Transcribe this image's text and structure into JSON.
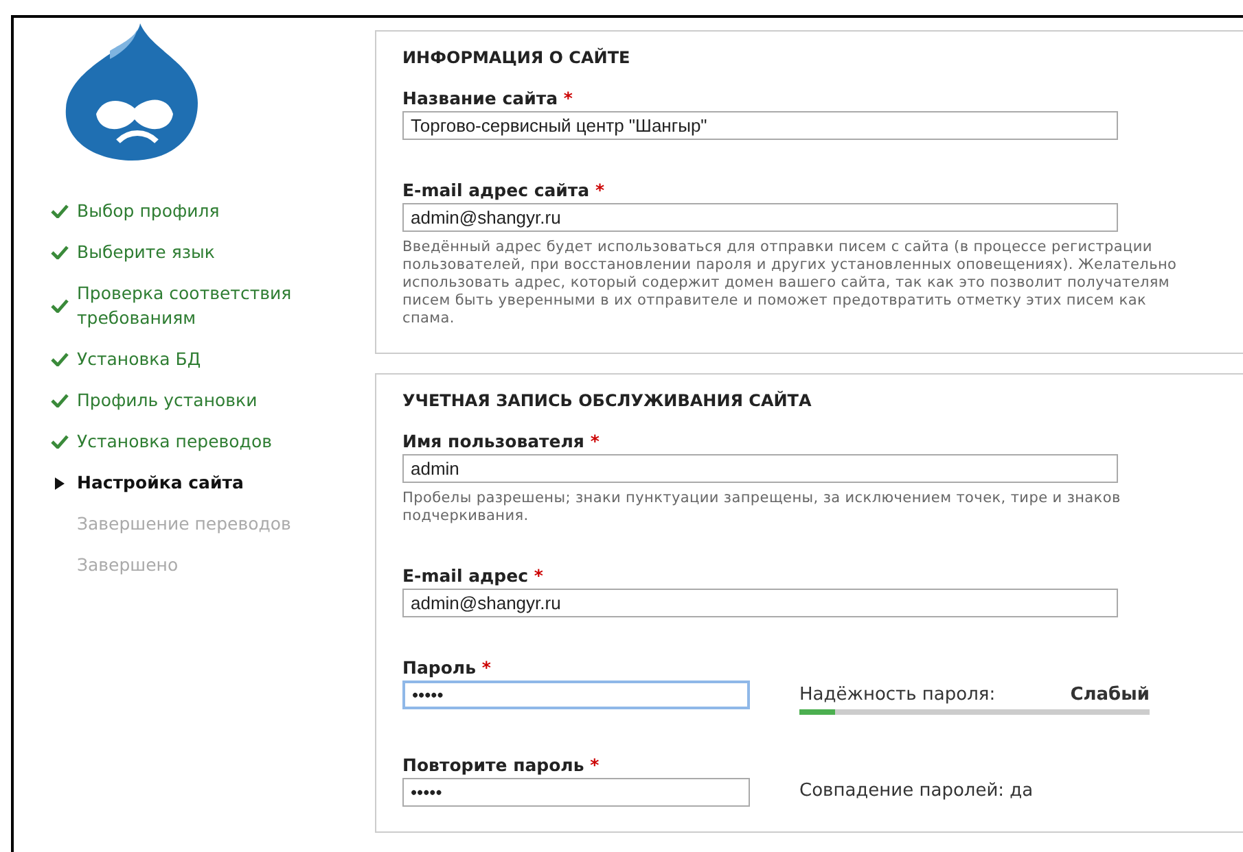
{
  "steps": [
    {
      "label": "Выбор профиля",
      "kind": "done"
    },
    {
      "label": "Выберите язык",
      "kind": "done"
    },
    {
      "label": "Проверка соответствия требованиям",
      "kind": "done"
    },
    {
      "label": "Установка БД",
      "kind": "done"
    },
    {
      "label": "Профиль установки",
      "kind": "done"
    },
    {
      "label": "Установка переводов",
      "kind": "done"
    },
    {
      "label": "Настройка сайта",
      "kind": "active"
    },
    {
      "label": "Завершение переводов",
      "kind": "pending"
    },
    {
      "label": "Завершено",
      "kind": "pending"
    }
  ],
  "fieldsets": [
    {
      "title": "ИНФОРМАЦИЯ О САЙТЕ",
      "fields": [
        {
          "kind": "text",
          "label": "Название сайта",
          "required_mark": "*",
          "value": "Торгово-сервисный центр \"Шангыр\""
        },
        {
          "kind": "text",
          "label": "E-mail адрес сайта",
          "required_mark": "*",
          "value": "admin@shangyr.ru",
          "description": "Введённый адрес будет использоваться для отправки писем с сайта (в процессе регистрации пользователей, при восстановлении пароля и других установленных оповещениях). Желательно использовать адрес, который содержит домен вашего сайта, так как это позволит получателям писем быть уверенными в их отправителе и поможет предотвратить отметку этих писем как спама."
        }
      ]
    },
    {
      "title": "УЧЕТНАЯ ЗАПИСЬ ОБСЛУЖИВАНИЯ САЙТА",
      "fields": [
        {
          "kind": "text",
          "label": "Имя пользователя",
          "required_mark": "*",
          "value": "admin",
          "description": "Пробелы разрешены; знаки пунктуации запрещены, за исключением точек, тире и знаков подчеркивания."
        },
        {
          "kind": "text",
          "label": "E-mail адрес",
          "required_mark": "*",
          "value": "admin@shangyr.ru"
        },
        {
          "kind": "password",
          "label": "Пароль",
          "required_mark": "*",
          "value": "•••••",
          "focused": true,
          "strength": {
            "label": "Надёжность пароля:",
            "rating": "Слабый",
            "level": 0.1
          }
        },
        {
          "kind": "confirm",
          "label": "Повторите пароль",
          "required_mark": "*",
          "value": "•••••",
          "match": "Совпадение паролей: да"
        }
      ]
    }
  ]
}
